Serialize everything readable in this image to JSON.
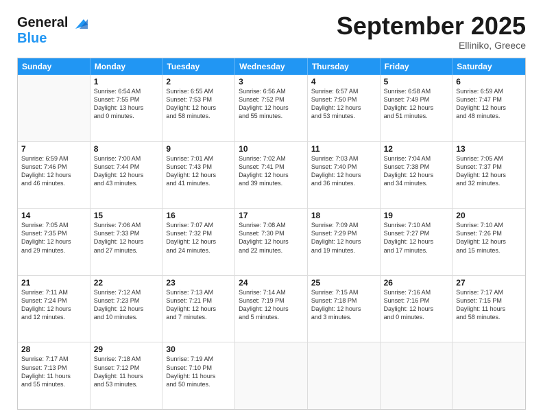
{
  "header": {
    "logo_line1": "General",
    "logo_line2": "Blue",
    "month": "September 2025",
    "location": "Elliniko, Greece"
  },
  "days": [
    "Sunday",
    "Monday",
    "Tuesday",
    "Wednesday",
    "Thursday",
    "Friday",
    "Saturday"
  ],
  "rows": [
    [
      {
        "day": "",
        "lines": []
      },
      {
        "day": "1",
        "lines": [
          "Sunrise: 6:54 AM",
          "Sunset: 7:55 PM",
          "Daylight: 13 hours",
          "and 0 minutes."
        ]
      },
      {
        "day": "2",
        "lines": [
          "Sunrise: 6:55 AM",
          "Sunset: 7:53 PM",
          "Daylight: 12 hours",
          "and 58 minutes."
        ]
      },
      {
        "day": "3",
        "lines": [
          "Sunrise: 6:56 AM",
          "Sunset: 7:52 PM",
          "Daylight: 12 hours",
          "and 55 minutes."
        ]
      },
      {
        "day": "4",
        "lines": [
          "Sunrise: 6:57 AM",
          "Sunset: 7:50 PM",
          "Daylight: 12 hours",
          "and 53 minutes."
        ]
      },
      {
        "day": "5",
        "lines": [
          "Sunrise: 6:58 AM",
          "Sunset: 7:49 PM",
          "Daylight: 12 hours",
          "and 51 minutes."
        ]
      },
      {
        "day": "6",
        "lines": [
          "Sunrise: 6:59 AM",
          "Sunset: 7:47 PM",
          "Daylight: 12 hours",
          "and 48 minutes."
        ]
      }
    ],
    [
      {
        "day": "7",
        "lines": [
          "Sunrise: 6:59 AM",
          "Sunset: 7:46 PM",
          "Daylight: 12 hours",
          "and 46 minutes."
        ]
      },
      {
        "day": "8",
        "lines": [
          "Sunrise: 7:00 AM",
          "Sunset: 7:44 PM",
          "Daylight: 12 hours",
          "and 43 minutes."
        ]
      },
      {
        "day": "9",
        "lines": [
          "Sunrise: 7:01 AM",
          "Sunset: 7:43 PM",
          "Daylight: 12 hours",
          "and 41 minutes."
        ]
      },
      {
        "day": "10",
        "lines": [
          "Sunrise: 7:02 AM",
          "Sunset: 7:41 PM",
          "Daylight: 12 hours",
          "and 39 minutes."
        ]
      },
      {
        "day": "11",
        "lines": [
          "Sunrise: 7:03 AM",
          "Sunset: 7:40 PM",
          "Daylight: 12 hours",
          "and 36 minutes."
        ]
      },
      {
        "day": "12",
        "lines": [
          "Sunrise: 7:04 AM",
          "Sunset: 7:38 PM",
          "Daylight: 12 hours",
          "and 34 minutes."
        ]
      },
      {
        "day": "13",
        "lines": [
          "Sunrise: 7:05 AM",
          "Sunset: 7:37 PM",
          "Daylight: 12 hours",
          "and 32 minutes."
        ]
      }
    ],
    [
      {
        "day": "14",
        "lines": [
          "Sunrise: 7:05 AM",
          "Sunset: 7:35 PM",
          "Daylight: 12 hours",
          "and 29 minutes."
        ]
      },
      {
        "day": "15",
        "lines": [
          "Sunrise: 7:06 AM",
          "Sunset: 7:33 PM",
          "Daylight: 12 hours",
          "and 27 minutes."
        ]
      },
      {
        "day": "16",
        "lines": [
          "Sunrise: 7:07 AM",
          "Sunset: 7:32 PM",
          "Daylight: 12 hours",
          "and 24 minutes."
        ]
      },
      {
        "day": "17",
        "lines": [
          "Sunrise: 7:08 AM",
          "Sunset: 7:30 PM",
          "Daylight: 12 hours",
          "and 22 minutes."
        ]
      },
      {
        "day": "18",
        "lines": [
          "Sunrise: 7:09 AM",
          "Sunset: 7:29 PM",
          "Daylight: 12 hours",
          "and 19 minutes."
        ]
      },
      {
        "day": "19",
        "lines": [
          "Sunrise: 7:10 AM",
          "Sunset: 7:27 PM",
          "Daylight: 12 hours",
          "and 17 minutes."
        ]
      },
      {
        "day": "20",
        "lines": [
          "Sunrise: 7:10 AM",
          "Sunset: 7:26 PM",
          "Daylight: 12 hours",
          "and 15 minutes."
        ]
      }
    ],
    [
      {
        "day": "21",
        "lines": [
          "Sunrise: 7:11 AM",
          "Sunset: 7:24 PM",
          "Daylight: 12 hours",
          "and 12 minutes."
        ]
      },
      {
        "day": "22",
        "lines": [
          "Sunrise: 7:12 AM",
          "Sunset: 7:23 PM",
          "Daylight: 12 hours",
          "and 10 minutes."
        ]
      },
      {
        "day": "23",
        "lines": [
          "Sunrise: 7:13 AM",
          "Sunset: 7:21 PM",
          "Daylight: 12 hours",
          "and 7 minutes."
        ]
      },
      {
        "day": "24",
        "lines": [
          "Sunrise: 7:14 AM",
          "Sunset: 7:19 PM",
          "Daylight: 12 hours",
          "and 5 minutes."
        ]
      },
      {
        "day": "25",
        "lines": [
          "Sunrise: 7:15 AM",
          "Sunset: 7:18 PM",
          "Daylight: 12 hours",
          "and 3 minutes."
        ]
      },
      {
        "day": "26",
        "lines": [
          "Sunrise: 7:16 AM",
          "Sunset: 7:16 PM",
          "Daylight: 12 hours",
          "and 0 minutes."
        ]
      },
      {
        "day": "27",
        "lines": [
          "Sunrise: 7:17 AM",
          "Sunset: 7:15 PM",
          "Daylight: 11 hours",
          "and 58 minutes."
        ]
      }
    ],
    [
      {
        "day": "28",
        "lines": [
          "Sunrise: 7:17 AM",
          "Sunset: 7:13 PM",
          "Daylight: 11 hours",
          "and 55 minutes."
        ]
      },
      {
        "day": "29",
        "lines": [
          "Sunrise: 7:18 AM",
          "Sunset: 7:12 PM",
          "Daylight: 11 hours",
          "and 53 minutes."
        ]
      },
      {
        "day": "30",
        "lines": [
          "Sunrise: 7:19 AM",
          "Sunset: 7:10 PM",
          "Daylight: 11 hours",
          "and 50 minutes."
        ]
      },
      {
        "day": "",
        "lines": []
      },
      {
        "day": "",
        "lines": []
      },
      {
        "day": "",
        "lines": []
      },
      {
        "day": "",
        "lines": []
      }
    ]
  ]
}
